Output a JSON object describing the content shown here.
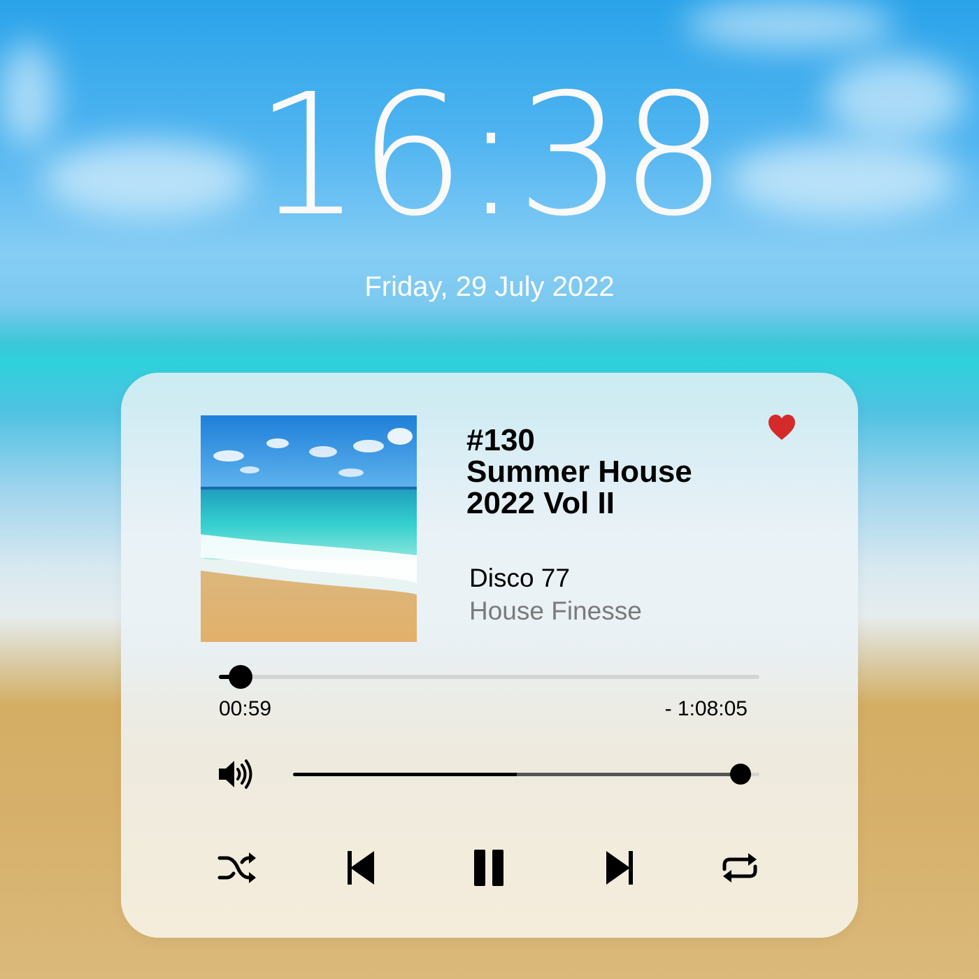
{
  "lockscreen": {
    "time": "16:38",
    "date": "Friday, 29 July 2022"
  },
  "player": {
    "title_lines": [
      "#130",
      "Summer House",
      "2022 Vol II"
    ],
    "track": "Disco 77",
    "artist": "House Finesse",
    "favorite": true,
    "elapsed": "00:59",
    "remaining": "- 1:08:05",
    "progress_fraction": 0.04,
    "volume_fraction": 0.96,
    "accent_color": "#d42a2a",
    "icons": {
      "favorite": "heart-icon",
      "volume": "speaker-icon",
      "shuffle": "shuffle-icon",
      "previous": "skip-previous-icon",
      "play_pause": "pause-icon",
      "next": "skip-next-icon",
      "repeat": "repeat-icon"
    }
  }
}
